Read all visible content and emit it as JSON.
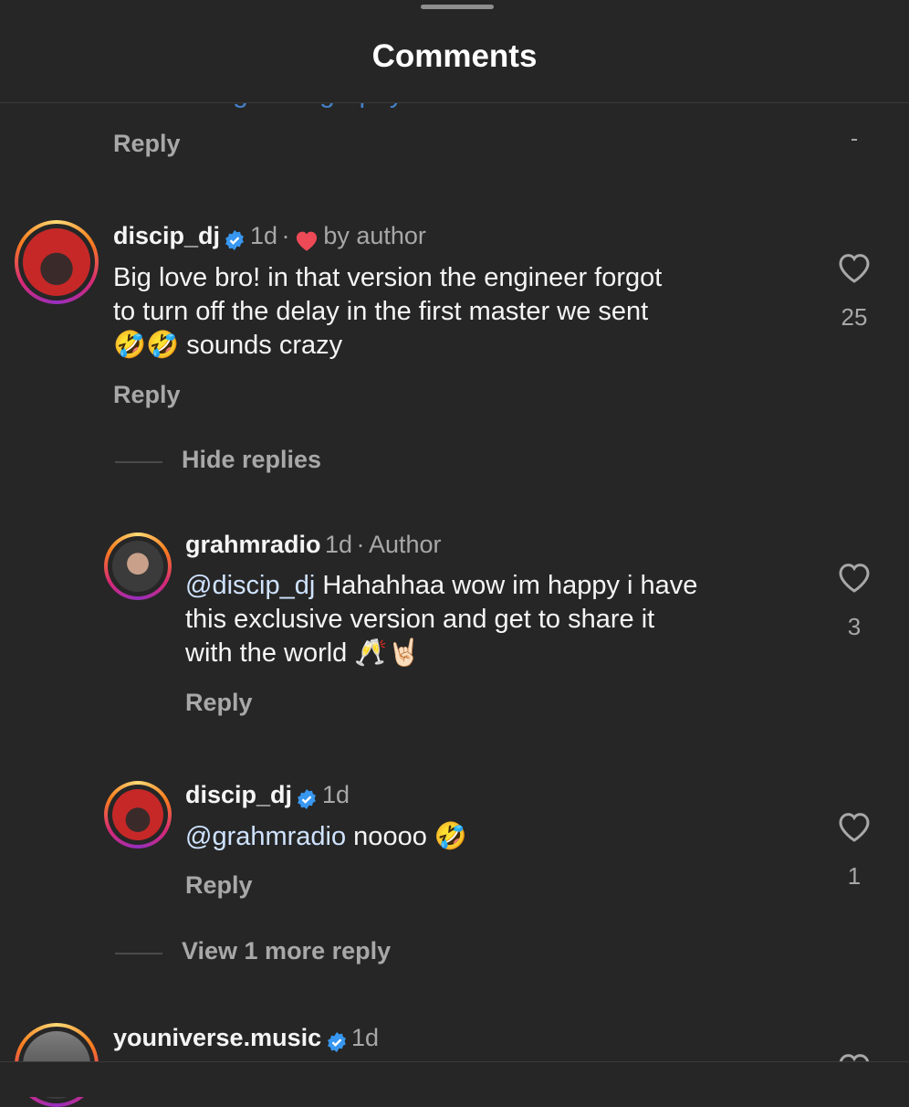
{
  "header": {
    "title": "Comments"
  },
  "partial_top": {
    "link_text": "ENZO is burning discography",
    "reply": "Reply"
  },
  "comments": [
    {
      "username": "discip_dj",
      "time": "1d",
      "separator": "·",
      "liked_by_author": "by author",
      "text_lines": [
        "Big love bro!  in that version the  engineer forgot",
        "to turn off the delay in the first master we sent",
        "🤣🤣 sounds crazy"
      ],
      "likes": "25",
      "reply": "Reply"
    }
  ],
  "hide_replies": "Hide replies",
  "replies": [
    {
      "username": "grahmradio",
      "time": "1d",
      "separator": "·",
      "tag": "Author",
      "mention": "@discip_dj",
      "text_lines": [
        " Hahahhaa wow im happy i have",
        "this exclusive version and get to share it",
        "with the world 🥂🤘🏻"
      ],
      "likes": "3",
      "reply": "Reply"
    },
    {
      "username": "discip_dj",
      "time": "1d",
      "mention": "@grahmradio",
      "text": " noooo 🤣",
      "likes": "1",
      "reply": "Reply"
    }
  ],
  "view_more": "View 1 more reply",
  "next_comment": {
    "username": "youniverse.music",
    "time": "1d"
  },
  "colors": {
    "background": "#262626",
    "verified": "#3897f0",
    "heart_red": "#ed4956",
    "muted": "#a8a8a8"
  },
  "icons": [
    "verified-badge-icon",
    "heart-outline-icon",
    "red-heart-icon"
  ]
}
